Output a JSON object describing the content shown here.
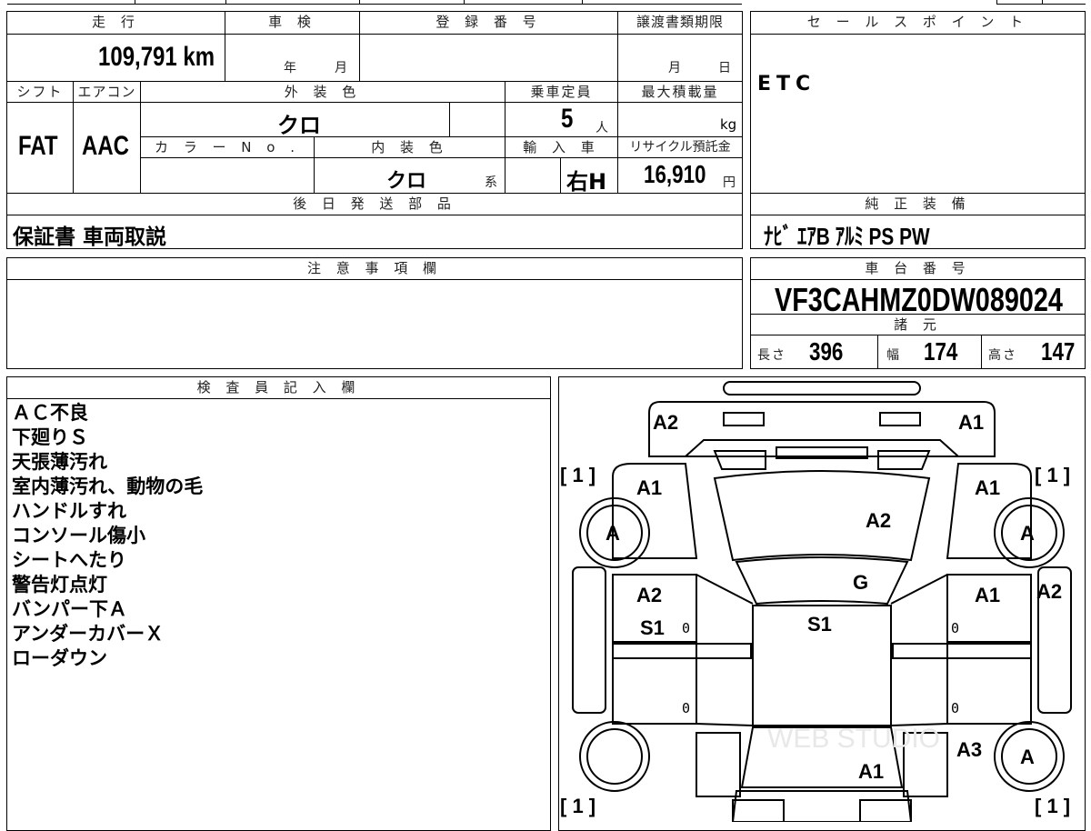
{
  "headers": {
    "mileage": "走 行",
    "inspection": "車 検",
    "registration": "登 録 番 号",
    "transfer": "譲渡書類期限",
    "sales_point": "セ ー ル ス ポ イ ン ト",
    "shift": "シフト",
    "aircon": "エアコン",
    "exterior_color": "外 装 色",
    "capacity": "乗車定員",
    "max_load": "最大積載量",
    "color_no": "カ ラ ー N o .",
    "interior_color": "内 装 色",
    "import": "輸 入 車",
    "recycle": "リサイクル預託金",
    "later_parts": "後 日 発 送 部 品",
    "genuine_equipment": "純 正 装 備",
    "caution": "注 意 事 項 欄",
    "chassis_number": "車 台 番 号",
    "specs": "諸 元",
    "inspector": "検 査 員 記 入 欄"
  },
  "values": {
    "mileage": "109,791 km",
    "year_unit": "年",
    "month_unit": "月",
    "transfer_month": "月",
    "transfer_day": "日",
    "sales_point": "ETC",
    "shift": "FAT",
    "aircon": "AAC",
    "exterior_color": "クロ",
    "capacity": "5",
    "capacity_unit": "人",
    "max_load_unit": "kg",
    "interior_color": "クロ",
    "interior_suffix": "系",
    "import": "右H",
    "recycle": "16,910",
    "recycle_unit": "円",
    "later_parts": "保証書 車両取説",
    "genuine_equipment": "ﾅﾋﾞ ｴｱB ｱﾙﾐ PS PW",
    "chassis_number": "VF3CAHMZ0DW089024",
    "length_label": "長さ",
    "length": "396",
    "width_label": "幅",
    "width": "174",
    "height_label": "高さ",
    "height": "147"
  },
  "inspector_notes": [
    "ＡＣ不良",
    "下廻りＳ",
    "天張薄汚れ",
    "室内薄汚れ、動物の毛",
    "ハンドルすれ",
    "コンソール傷小",
    "シートへたり",
    "警告灯点灯",
    "バンパー下Ａ",
    "アンダーカバーＸ",
    "ローダウン"
  ],
  "diagram": {
    "front_left": "A2",
    "front_right": "A1",
    "fender_left": "A1",
    "fender_right": "A1",
    "hood": "A2",
    "windshield": "G",
    "wheel_fl": "A",
    "wheel_fr": "A",
    "wheel_rr": "A",
    "tire_fl": "[ 1 ]",
    "tire_fr": "[ 1 ]",
    "tire_rl": "[ 1 ]",
    "tire_rr": "[ 1 ]",
    "door_fl_a": "A2",
    "door_fl_b": "S1",
    "roof": "S1",
    "door_fr": "A1",
    "pillar_r": "A2",
    "rear_quarter_r": "A3",
    "trunk": "A1",
    "zero": "0",
    "watermark": "WEB STUDIO"
  }
}
